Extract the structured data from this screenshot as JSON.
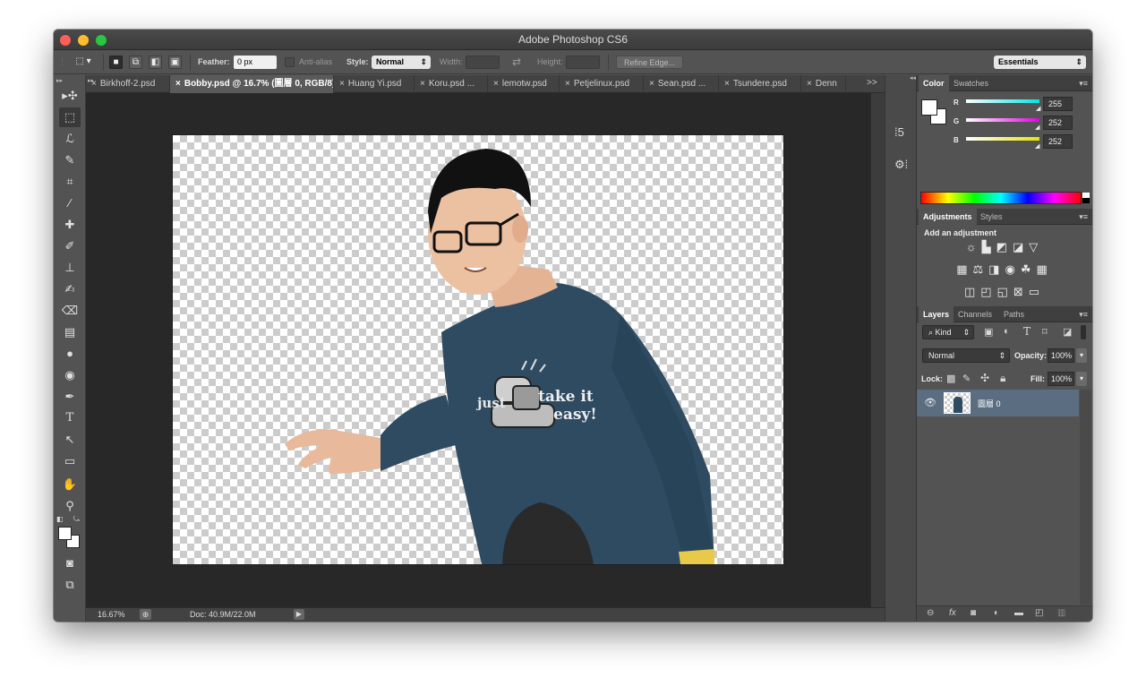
{
  "app": {
    "title": "Adobe Photoshop CS6"
  },
  "options": {
    "feather_label": "Feather:",
    "feather_value": "0 px",
    "antialias_label": "Anti-alias",
    "style_label": "Style:",
    "style_value": "Normal",
    "width_label": "Width:",
    "height_label": "Height:",
    "refine_edge": "Refine Edge...",
    "workspace": "Essentials"
  },
  "tabs": [
    "Birkhoff-2.psd",
    "Bobby.psd @ 16.7% (圖層 0, RGB/8)",
    "Huang Yi.psd",
    "Koru.psd ...",
    "lemotw.psd",
    "Petjelinux.psd",
    "Sean.psd ...",
    "Tsundere.psd",
    "Denn"
  ],
  "tabs_close": "×",
  "tabs_more": ">>",
  "canvas": {
    "shirt_text_1": "just",
    "shirt_text_2": "take it",
    "shirt_text_3": "easy!"
  },
  "status": {
    "zoom": "16.67%",
    "doc": "Doc: 40.9M/22.0M"
  },
  "color_panel": {
    "tabs": [
      "Color",
      "Swatches"
    ],
    "channels": [
      {
        "label": "R",
        "value": "255",
        "color": "#00e5e5"
      },
      {
        "label": "G",
        "value": "252",
        "color": "#e000e0"
      },
      {
        "label": "B",
        "value": "252",
        "color": "#e5e500"
      }
    ]
  },
  "adjustments_panel": {
    "tabs": [
      "Adjustments",
      "Styles"
    ],
    "heading": "Add an adjustment"
  },
  "layers_panel": {
    "tabs": [
      "Layers",
      "Channels",
      "Paths"
    ],
    "kind": "Kind",
    "blend_mode": "Normal",
    "opacity_label": "Opacity:",
    "opacity_value": "100%",
    "lock_label": "Lock:",
    "fill_label": "Fill:",
    "fill_value": "100%",
    "layers": [
      {
        "name": "圖層 0",
        "selected": true
      }
    ]
  },
  "colors": {
    "selected_layer": "#5b6d80",
    "shirt": "#2e4b62",
    "canvas_bg": "#282828"
  }
}
